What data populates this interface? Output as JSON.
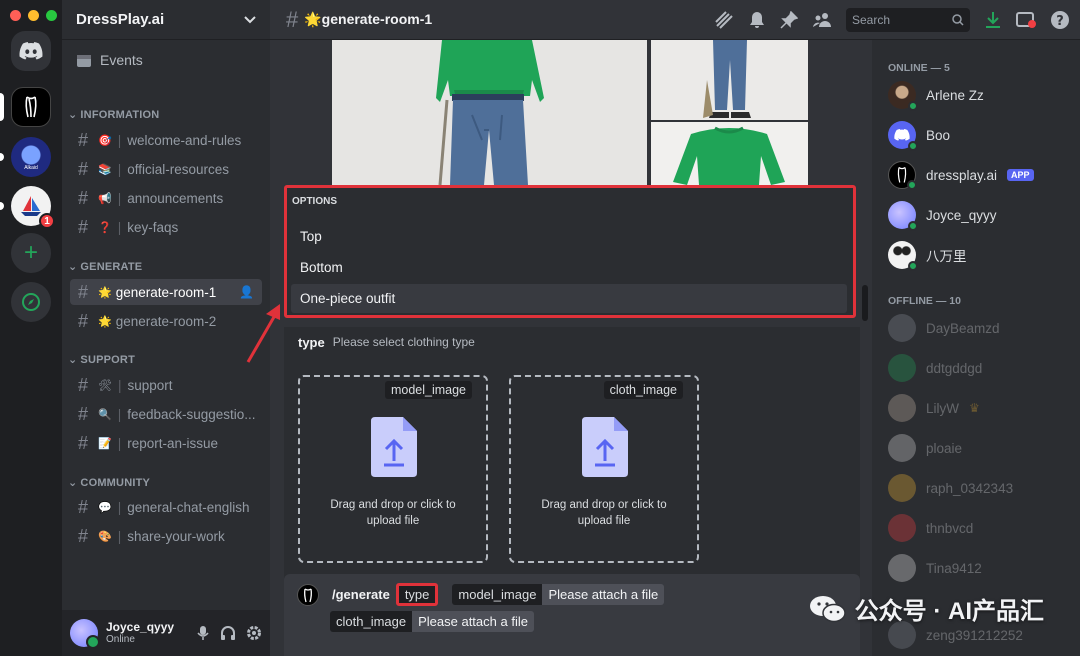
{
  "server": {
    "name": "DressPlay.ai",
    "alkaid_label": "Alkaid",
    "notifications": "1"
  },
  "sidebar": {
    "events_label": "Events",
    "categories": [
      {
        "name": "INFORMATION",
        "channels": [
          {
            "emoji": "🎯",
            "name": "welcome-and-rules"
          },
          {
            "emoji": "📚",
            "name": "official-resources"
          },
          {
            "emoji": "📢",
            "name": "announcements"
          },
          {
            "emoji": "❓",
            "name": "key-faqs"
          }
        ]
      },
      {
        "name": "GENERATE",
        "channels": [
          {
            "emoji": "🌟",
            "name": "generate-room-1",
            "active": true
          },
          {
            "emoji": "🌟",
            "name": "generate-room-2"
          }
        ]
      },
      {
        "name": "SUPPORT",
        "channels": [
          {
            "emoji": "🛠",
            "name": "support"
          },
          {
            "emoji": "🔍",
            "name": "feedback-suggestio..."
          },
          {
            "emoji": "📝",
            "name": "report-an-issue"
          }
        ]
      },
      {
        "name": "COMMUNITY",
        "channels": [
          {
            "emoji": "💬",
            "name": "general-chat-english"
          },
          {
            "emoji": "🎨",
            "name": "share-your-work"
          }
        ]
      }
    ],
    "separator": "|"
  },
  "user": {
    "name": "Joyce_qyyy",
    "status": "Online"
  },
  "topbar": {
    "channel": "🌟generate-room-1",
    "search_placeholder": "Search"
  },
  "options": {
    "header": "OPTIONS",
    "items": [
      "Top",
      "Bottom",
      "One-piece outfit"
    ]
  },
  "type_field": {
    "name": "type",
    "hint": "Please select clothing type"
  },
  "uploads": [
    {
      "tag": "model_image",
      "text": "Drag and drop or click to upload file"
    },
    {
      "tag": "cloth_image",
      "text": "Drag and drop or click to upload file"
    }
  ],
  "command": {
    "slash": "/generate",
    "type_label": "type",
    "model_label": "model_image",
    "model_value": "Please attach a file",
    "cloth_label": "cloth_image",
    "cloth_value": "Please attach a file"
  },
  "members": {
    "online_header": "ONLINE — 5",
    "offline_header": "OFFLINE — 10",
    "online": [
      {
        "name": "Arlene Zz"
      },
      {
        "name": "Boo"
      },
      {
        "name": "dressplay.ai",
        "tag": "APP"
      },
      {
        "name": "Joyce_qyyy"
      },
      {
        "name": "八万里"
      }
    ],
    "offline": [
      {
        "name": "DayBeamzd"
      },
      {
        "name": "ddtgddgd"
      },
      {
        "name": "LilyW"
      },
      {
        "name": "ploaie"
      },
      {
        "name": "raph_0342343"
      },
      {
        "name": "thnbvcd"
      },
      {
        "name": "Tina9412"
      },
      {
        "name": "zeng391212252"
      }
    ]
  },
  "watermark": "公众号 · AI产品汇",
  "colors": {
    "accent": "#5865f2",
    "highlight": "#e0323a",
    "online": "#23a55a"
  }
}
